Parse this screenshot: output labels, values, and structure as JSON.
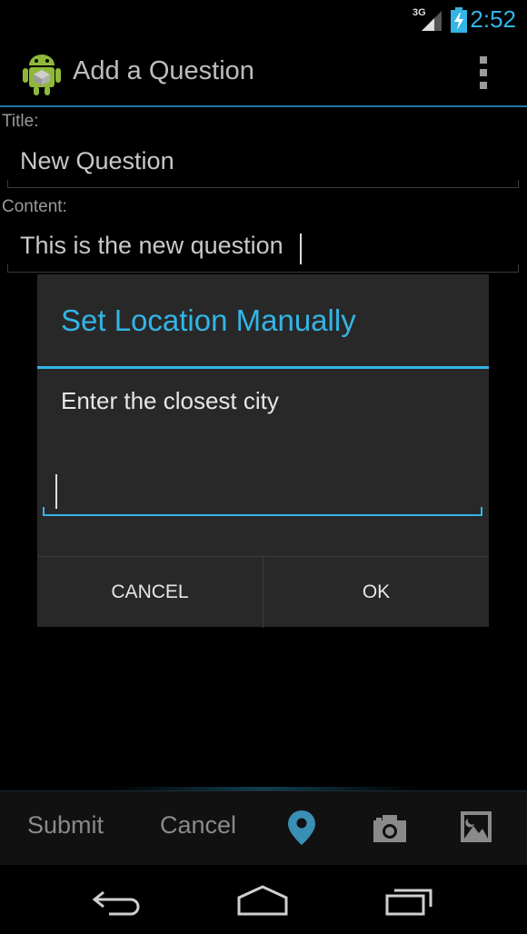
{
  "status_bar": {
    "network": "3G",
    "time": "2:52"
  },
  "action_bar": {
    "title": "Add a Question",
    "icon": "android-robot-icon",
    "overflow_icon": "overflow-menu-icon"
  },
  "form": {
    "title_label": "Title:",
    "title_value": "New Question",
    "content_label": "Content:",
    "content_value": "This is the new question"
  },
  "dialog": {
    "title": "Set Location Manually",
    "message": "Enter the closest city",
    "input_value": "",
    "cancel_label": "CANCEL",
    "ok_label": "OK"
  },
  "bottom_bar": {
    "submit_label": "Submit",
    "cancel_label": "Cancel",
    "icons": [
      "location-pin-icon",
      "camera-icon",
      "gallery-icon"
    ]
  },
  "nav_bar": {
    "icons": [
      "back-icon",
      "home-icon",
      "recent-apps-icon"
    ]
  },
  "colors": {
    "accent": "#33b5e5",
    "dialog_bg": "#282828",
    "background": "#000000"
  }
}
